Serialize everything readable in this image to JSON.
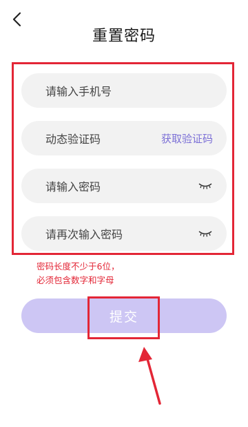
{
  "header": {
    "title": "重置密码"
  },
  "form": {
    "phone_placeholder": "请输入手机号",
    "code_placeholder": "动态验证码",
    "get_code_label": "获取验证码",
    "password_placeholder": "请输入密码",
    "confirm_placeholder": "请再次输入密码"
  },
  "hint": {
    "line1": "密码长度不少于6位，",
    "line2": "必须包含数字和字母"
  },
  "submit": {
    "label": "提交"
  },
  "icons": {
    "back": "chevron-left-icon",
    "password_visibility": "eye-closed-icon",
    "annotation_arrow": "arrow-up-left-icon"
  },
  "colors": {
    "accent": "#7b6fd6",
    "button_bg": "#cdc6f4",
    "field_bg": "#f2f2f2",
    "annotation_red": "#e32636"
  }
}
